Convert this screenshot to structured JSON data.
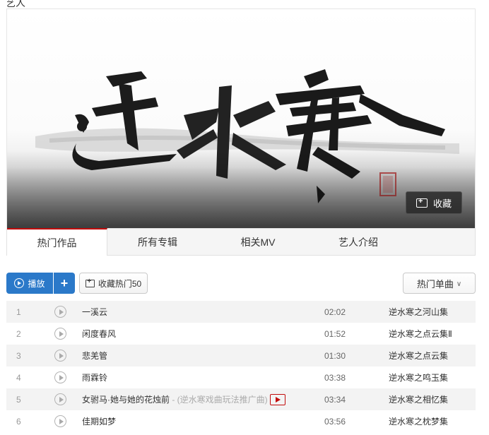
{
  "header": {
    "fragment": "艺人"
  },
  "banner": {
    "artwork_title": "逆水寒",
    "collect_label": "收藏"
  },
  "tabs": [
    {
      "label": "热门作品",
      "active": true
    },
    {
      "label": "所有专辑",
      "active": false
    },
    {
      "label": "相关MV",
      "active": false
    },
    {
      "label": "艺人介绍",
      "active": false
    }
  ],
  "toolbar": {
    "play_label": "播放",
    "add_label": "+",
    "favorite_label": "收藏热门50",
    "sort_label": "热门单曲"
  },
  "songs": [
    {
      "index": "1",
      "title": "一溪云",
      "subtitle": "",
      "has_mv": false,
      "duration": "02:02",
      "album": "逆水寒之河山集"
    },
    {
      "index": "2",
      "title": "闲度春风",
      "subtitle": "",
      "has_mv": false,
      "duration": "01:52",
      "album": "逆水寒之点云集Ⅱ"
    },
    {
      "index": "3",
      "title": "悲羌管",
      "subtitle": "",
      "has_mv": false,
      "duration": "01:30",
      "album": "逆水寒之点云集"
    },
    {
      "index": "4",
      "title": "雨霖铃",
      "subtitle": "",
      "has_mv": false,
      "duration": "03:38",
      "album": "逆水寒之鸣玉集"
    },
    {
      "index": "5",
      "title": "女驸马·她与她的花烛前",
      "subtitle": " - (逆水寒戏曲玩法推广曲)",
      "has_mv": true,
      "duration": "03:34",
      "album": "逆水寒之相忆集"
    },
    {
      "index": "6",
      "title": "佳期如梦",
      "subtitle": "",
      "has_mv": false,
      "duration": "03:56",
      "album": "逆水寒之枕梦集"
    }
  ],
  "colors": {
    "accent_red": "#c20c0c",
    "play_blue": "#2b79c9",
    "row_stripe": "#f3f3f3"
  }
}
